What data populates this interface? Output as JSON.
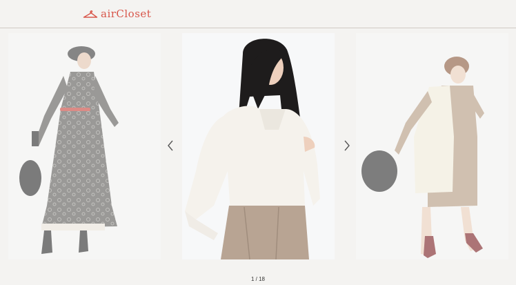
{
  "header": {
    "logo_text": "airCloset",
    "logo_icon": "hanger-icon",
    "brand_color": "#d8564a"
  },
  "carousel": {
    "current_page": 1,
    "total_pages": 18,
    "pager_text": "1 / 18",
    "prev_icon": "chevron-left-icon",
    "next_icon": "chevron-right-icon",
    "slides": [
      {
        "position": "left",
        "outfit": "paisley maxi dress, black beret, red belt, faux fur bag, ankle boots"
      },
      {
        "position": "center",
        "outfit": "white blouse with puff sleeves, beige pleated trousers"
      },
      {
        "position": "right",
        "outfit": "cream long vest, beige knit dress, faux fur bag, burgundy heeled boots"
      }
    ]
  }
}
